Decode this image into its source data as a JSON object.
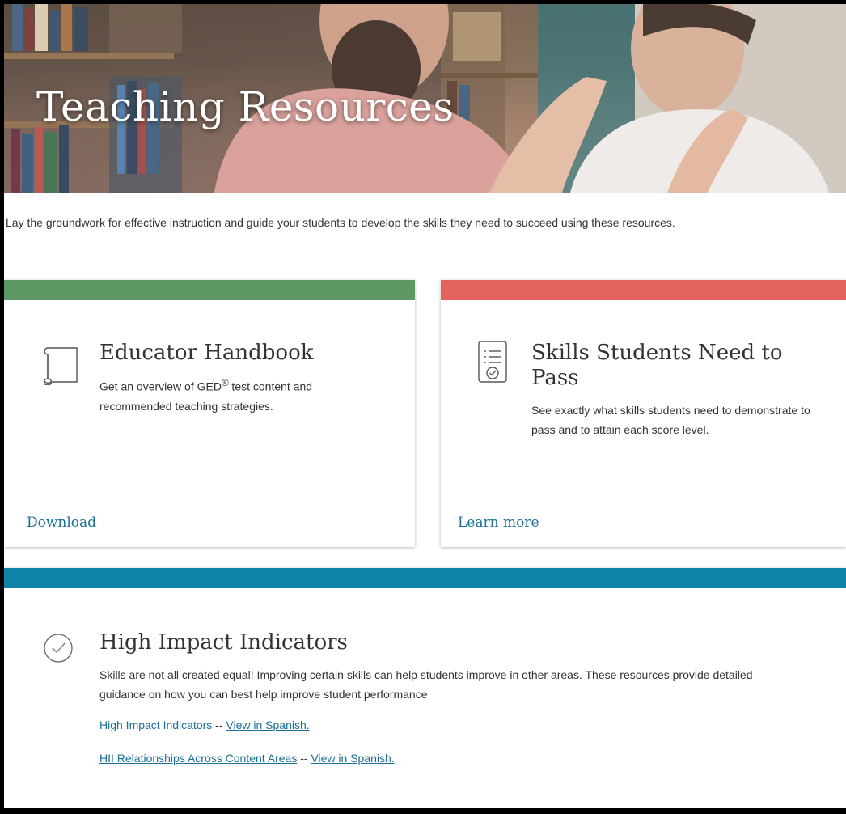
{
  "hero": {
    "title": "Teaching Resources"
  },
  "intro": "Lay the groundwork for effective instruction and guide your students to develop the skills they need to succeed using these resources.",
  "cards": {
    "handbook": {
      "title": "Educator Handbook",
      "desc_before": "Get an overview of GED",
      "desc_sup": "®",
      "desc_after": " test content and recommended teaching strategies.",
      "link": "Download",
      "accent": "#5e9864",
      "icon": "book-scroll-icon"
    },
    "skills": {
      "title": "Skills Students Need to Pass",
      "desc": "See exactly what skills students need to demonstrate to pass and to attain each score level.",
      "link": "Learn more",
      "accent": "#e3625d",
      "icon": "checklist-document-icon"
    },
    "hii": {
      "title": "High Impact Indicators",
      "desc": "Skills are not all created equal! Improving certain skills can help students improve in other areas. These resources provide detailed guidance on how you can best help improve student performance",
      "links": [
        {
          "label": "High Impact Indicators",
          "separator": " -- ",
          "spanish": "View in Spanish."
        },
        {
          "label": "HII Relationships Across Content Areas",
          "separator": " -- ",
          "spanish": "View in Spanish."
        }
      ],
      "accent": "#0f82a8",
      "icon": "check-circle-icon"
    }
  },
  "colors": {
    "link": "#1c6f96",
    "text": "#333333"
  }
}
